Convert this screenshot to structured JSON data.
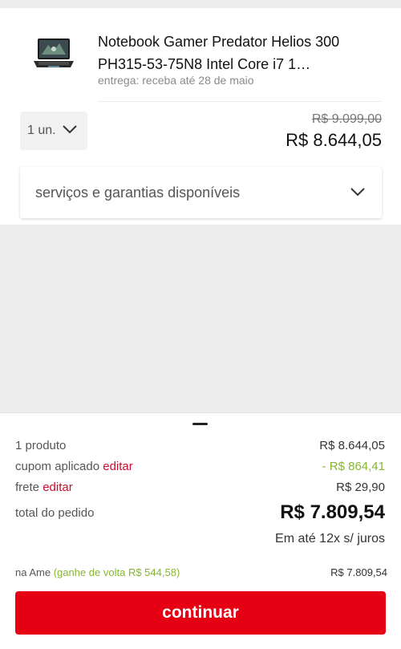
{
  "product": {
    "title": "Notebook Gamer Predator Helios 300 PH315-53-75N8 Intel Core i7 1…",
    "delivery": "entrega: receba até 28 de maio",
    "image_icon": "laptop-image",
    "quantity": "1 un.",
    "old_price": "R$ 9.099,00",
    "price": "R$ 8.644,05"
  },
  "services": {
    "label": "serviços e garantias disponíveis"
  },
  "summary": {
    "products_label": "1 produto",
    "products_value": "R$ 8.644,05",
    "coupon_label": "cupom aplicado",
    "coupon_edit": "editar",
    "coupon_value": "- R$ 864,41",
    "shipping_label": "frete",
    "shipping_edit": "editar",
    "shipping_value": "R$ 29,90",
    "total_label": "total do pedido",
    "total_value": "R$ 7.809,54",
    "installments": "Em até 12x s/ juros",
    "ame_label": "na Ame",
    "ame_cashback": "(ganhe de volta R$ 544,58)",
    "ame_value": "R$ 7.809,54"
  },
  "actions": {
    "continue_label": "continuar"
  },
  "colors": {
    "brand_red": "#e60014",
    "link_red": "#cc0c2f",
    "discount_green": "#86b62f"
  }
}
